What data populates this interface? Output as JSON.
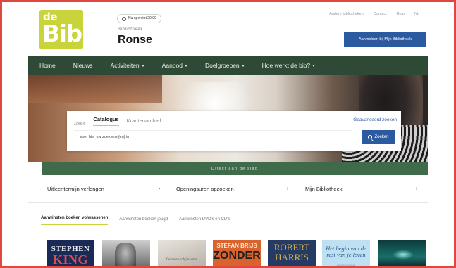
{
  "logo": {
    "line1": "de",
    "line2": "Bib"
  },
  "header": {
    "open_badge": "Nu open tot 20.00",
    "subtitle": "Bibliotheek",
    "library_name": "Ronse",
    "top_links": [
      "Andere bibliotheken",
      "Contact",
      "Hulp",
      "NL"
    ],
    "cta_label": "Aanmelden bij Mijn Bibliotheek"
  },
  "nav": {
    "items": [
      {
        "label": "Home",
        "has_caret": false
      },
      {
        "label": "Nieuws",
        "has_caret": false
      },
      {
        "label": "Activiteiten",
        "has_caret": true
      },
      {
        "label": "Aanbod",
        "has_caret": true
      },
      {
        "label": "Doelgroepen",
        "has_caret": true
      },
      {
        "label": "Hoe werkt de bib?",
        "has_caret": true
      }
    ]
  },
  "search": {
    "prefix": "Zoek in",
    "tabs": [
      "Catalogus",
      "Krantenarchief"
    ],
    "active_tab": "Catalogus",
    "advanced_link": "Geavanceerd zoeken",
    "placeholder": "Voer hier uw zoekterm(en) in",
    "button_label": "Zoeken"
  },
  "skip_bar": "Direct aan de slag",
  "quick_links": [
    "Uitleentermijn verlengen",
    "Openingsuren opzoeken",
    "Mijn Bibliotheek"
  ],
  "acquisitions": {
    "tabs": [
      "Aanwinsten boeken volwassenen",
      "Aanwinsten boeken jeugd",
      "Aanwinsten DVD's en CD's"
    ],
    "active_tab": "Aanwinsten boeken volwassenen"
  },
  "books": [
    {
      "line1": "STEPHEN",
      "line2": "KING"
    },
    {
      "line1": "",
      "line2": ""
    },
    {
      "line1": "De zeven schijnvoeten",
      "line2": ""
    },
    {
      "line1": "STEFAN BRIJS",
      "line2": "ZONDER"
    },
    {
      "line1": "ROBERT",
      "line2": "HARRIS"
    },
    {
      "line1": "Het begin van de rest van je leven",
      "line2": "ROSS DIVINE"
    },
    {
      "line1": "",
      "line2": ""
    }
  ],
  "colors": {
    "brand_green": "#2e4a36",
    "accent_lime": "#c9d33a",
    "primary_blue": "#2c5aa0"
  }
}
